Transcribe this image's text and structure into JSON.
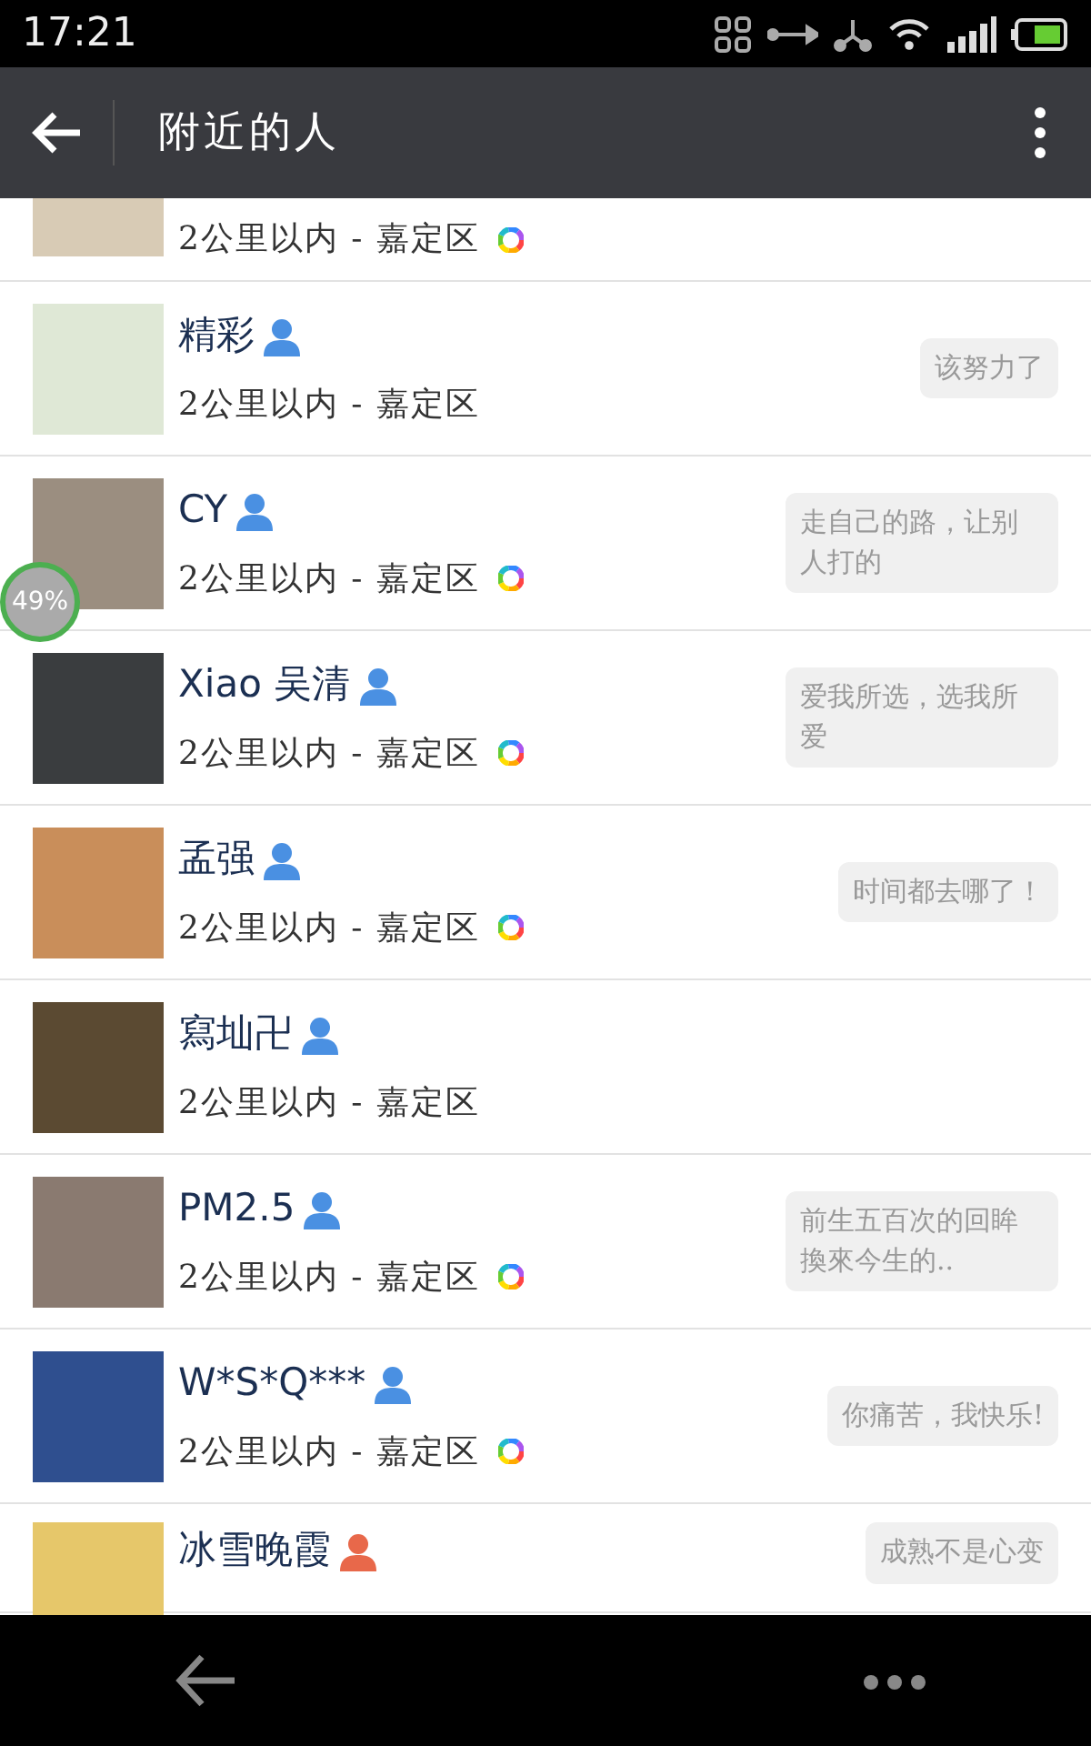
{
  "status_bar": {
    "time": "17:21"
  },
  "header": {
    "title": "附近的人"
  },
  "people": [
    {
      "kind": "partial",
      "distance": "2公里以内 - 嘉定区",
      "moments": true
    },
    {
      "kind": "full",
      "name": "精彩",
      "color": "#4a90e2",
      "distance": "2公里以内 - 嘉定区",
      "moments": false,
      "signature": "该努力了"
    },
    {
      "kind": "full",
      "name": "CY",
      "color": "#4a90e2",
      "distance": "2公里以内 - 嘉定区",
      "moments": true,
      "signature": "走自己的路，让别人打的"
    },
    {
      "kind": "full",
      "name": "Xiao 吴清",
      "color": "#4a90e2",
      "distance": "2公里以内 - 嘉定区",
      "moments": true,
      "signature": "爱我所选，选我所爱"
    },
    {
      "kind": "full",
      "name": "孟强",
      "color": "#4a90e2",
      "distance": "2公里以内 - 嘉定区",
      "moments": true,
      "signature": "时间都去哪了！"
    },
    {
      "kind": "full",
      "name": "寫圸卍",
      "color": "#4a90e2",
      "distance": "2公里以内 - 嘉定区",
      "moments": false
    },
    {
      "kind": "full",
      "name": "PM2.5",
      "color": "#4a90e2",
      "distance": "2公里以内 - 嘉定区",
      "moments": true,
      "signature": "前生五百次的回眸換來今生的.."
    },
    {
      "kind": "full",
      "name": "W*S*Q***",
      "color": "#4a90e2",
      "distance": "2公里以内 - 嘉定区",
      "moments": true,
      "signature": "你痛苦，我快乐!"
    },
    {
      "kind": "cut",
      "name": "冰雪晚霞",
      "color": "#e8684a",
      "signature": "成熟不是心变"
    }
  ],
  "floating_badge": {
    "text": "49%"
  }
}
